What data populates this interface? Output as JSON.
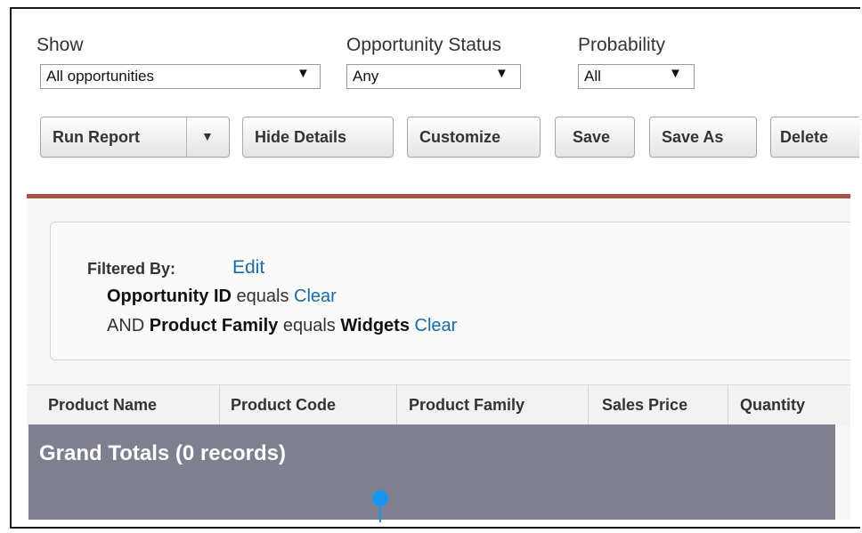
{
  "filters": {
    "show": {
      "label": "Show",
      "value": "All opportunities"
    },
    "status": {
      "label": "Opportunity Status",
      "value": "Any"
    },
    "probability": {
      "label": "Probability",
      "value": "All"
    },
    "dropdown_glyph": "▼"
  },
  "toolbar": {
    "run_report": "Run Report",
    "run_report_menu": "▼",
    "hide_details": "Hide Details",
    "customize": "Customize",
    "save": "Save",
    "save_as": "Save As",
    "delete": "Delete"
  },
  "filtered_by": {
    "label": "Filtered By:",
    "edit": "Edit",
    "line1": {
      "field": "Opportunity ID",
      "op": "equals",
      "clear": "Clear"
    },
    "line2": {
      "prefix": "AND",
      "field": "Product Family",
      "op": "equals",
      "value": "Widgets",
      "clear": "Clear"
    }
  },
  "table": {
    "columns": [
      "Product Name",
      "Product Code",
      "Product Family",
      "Sales Price",
      "Quantity"
    ],
    "grand_totals": "Grand Totals (0 records)"
  },
  "colors": {
    "accent_rule": "#a65544",
    "totals_bg": "#7e808f",
    "link": "#1a6aaa",
    "marker": "#1996f0"
  }
}
